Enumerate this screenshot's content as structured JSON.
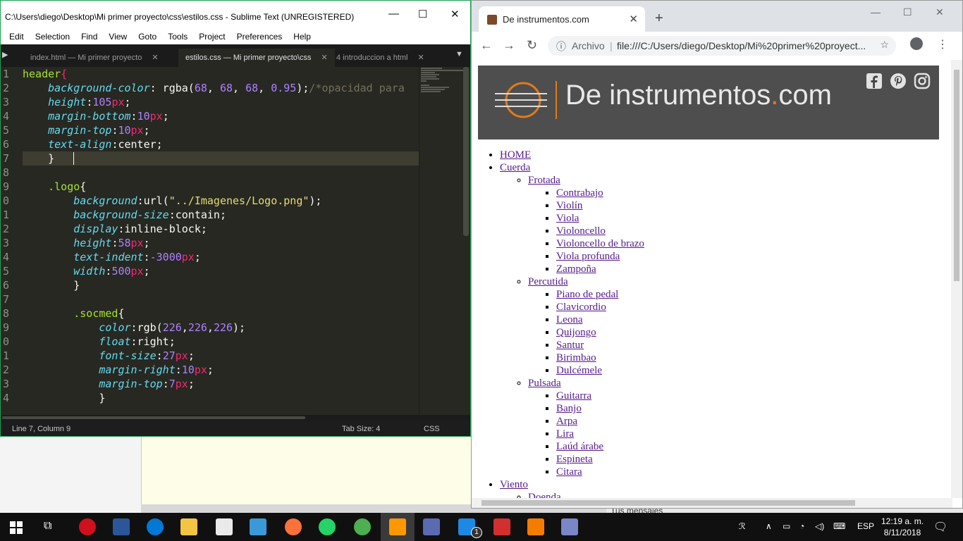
{
  "sublime": {
    "title": "C:\\Users\\diego\\Desktop\\Mi primer proyecto\\css\\estilos.css - Sublime Text (UNREGISTERED)",
    "menu": [
      "Edit",
      "Selection",
      "Find",
      "View",
      "Goto",
      "Tools",
      "Project",
      "Preferences",
      "Help"
    ],
    "tabs": [
      {
        "label": "index.html — Mi primer proyecto"
      },
      {
        "label": "estilos.css — Mi primer proyecto\\css"
      },
      {
        "label": "4 introduccion a html"
      }
    ],
    "line_numbers": [
      "1",
      "2",
      "3",
      "4",
      "5",
      "6",
      "7",
      "8",
      "9",
      "0",
      "1",
      "2",
      "3",
      "4",
      "5",
      "6",
      "7",
      "8",
      "9",
      "0",
      "1",
      "2",
      "3",
      "4"
    ],
    "status": {
      "position": "Line 7, Column 9",
      "tab_size": "Tab Size: 4",
      "syntax": "CSS"
    }
  },
  "chrome": {
    "tab_title": "De instrumentos.com",
    "address_label": "Archivo",
    "url": "file:///C:/Users/diego/Desktop/Mi%20primer%20proyect...",
    "logo_text": "De instrumentos",
    "logo_dot": ".",
    "logo_suffix": "com",
    "nav": {
      "home": "HOME",
      "cuerda": "Cuerda",
      "frotada": "Frotada",
      "frotada_items": [
        "Contrabajo",
        "Violín",
        "Viola",
        "Violoncello",
        "Violoncello de brazo",
        "Viola profunda",
        "Zampoña"
      ],
      "percutida": "Percutida",
      "percutida_items": [
        "Piano de pedal",
        "Clavicordio",
        "Leona",
        "Quijongo",
        "Santur",
        "Birimbao",
        "Dulcémele"
      ],
      "pulsada": "Pulsada",
      "pulsada_items": [
        "Guitarra",
        "Banjo",
        "Arpa",
        "Lira",
        "Laúd árabe",
        "Espineta",
        "Citara"
      ],
      "viento": "Viento",
      "cut_item": "Doenda"
    }
  },
  "background": {
    "message": "Tus mensajes"
  },
  "taskbar": {
    "lang": "ESP",
    "time": "12:19 a. m.",
    "date": "8/11/2018",
    "badge": "1"
  }
}
